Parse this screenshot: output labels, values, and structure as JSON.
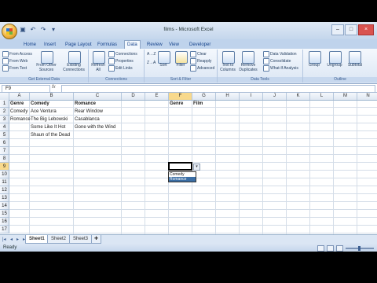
{
  "window": {
    "title": "films - Microsoft Excel",
    "qat_icons": [
      "save-icon",
      "undo-icon",
      "redo-icon"
    ],
    "controls": {
      "minimize": "–",
      "maximize": "□",
      "close": "×"
    }
  },
  "ribbon": {
    "tabs": [
      "Home",
      "Insert",
      "Page Layout",
      "Formulas",
      "Data",
      "Review",
      "View",
      "Developer"
    ],
    "active_tab": "Data",
    "groups": {
      "get_external_data": {
        "label": "Get External Data",
        "from_access": "From Access",
        "from_web": "From Web",
        "from_text": "From Text",
        "from_other_sources": "From Other Sources",
        "existing_connections": "Existing Connections"
      },
      "connections": {
        "label": "Connections",
        "refresh_all": "Refresh All",
        "connections": "Connections",
        "properties": "Properties",
        "edit_links": "Edit Links"
      },
      "sort_filter": {
        "label": "Sort & Filter",
        "sort_az": "A→Z",
        "sort_za": "Z→A",
        "sort": "Sort",
        "filter": "Filter",
        "clear": "Clear",
        "reapply": "Reapply",
        "advanced": "Advanced"
      },
      "data_tools": {
        "label": "Data Tools",
        "text_to_columns": "Text to Columns",
        "remove_duplicates": "Remove Duplicates",
        "data_validation": "Data Validation",
        "consolidate": "Consolidate",
        "what_if": "What-If Analysis"
      },
      "outline": {
        "label": "Outline",
        "group": "Group",
        "ungroup": "Ungroup",
        "subtotal": "Subtotal"
      }
    }
  },
  "formula_bar": {
    "name_box": "F9",
    "fx": "fx",
    "value": ""
  },
  "columns": [
    "A",
    "B",
    "C",
    "D",
    "E",
    "F",
    "G",
    "H",
    "I",
    "J",
    "K",
    "L",
    "M",
    "N"
  ],
  "rows": [
    "1",
    "2",
    "3",
    "4",
    "5",
    "6",
    "7",
    "8",
    "9",
    "10",
    "11",
    "12",
    "13",
    "14",
    "15",
    "16",
    "17"
  ],
  "selected_cell": {
    "col": "F",
    "row": "9"
  },
  "cells": {
    "A1": "Genre",
    "B1": "Comedy",
    "C1": "Romance",
    "F1": "Genre",
    "G1": "Film",
    "A2": "Comedy",
    "B2": "Ace Ventura",
    "C2": "Rear Window",
    "A3": "Romance",
    "B3": "The Big Lebowski",
    "C3": "Casablanca",
    "B4": "Some Like It Hot",
    "C4": "Gone with the Wind",
    "B5": "Shaun of the Dead"
  },
  "dropdown": {
    "options": [
      "Comedy",
      "Romance"
    ],
    "highlighted": "Romance"
  },
  "sheets": [
    "Sheet1",
    "Sheet2",
    "Sheet3"
  ],
  "active_sheet": "Sheet1",
  "status": {
    "text": "Ready"
  }
}
